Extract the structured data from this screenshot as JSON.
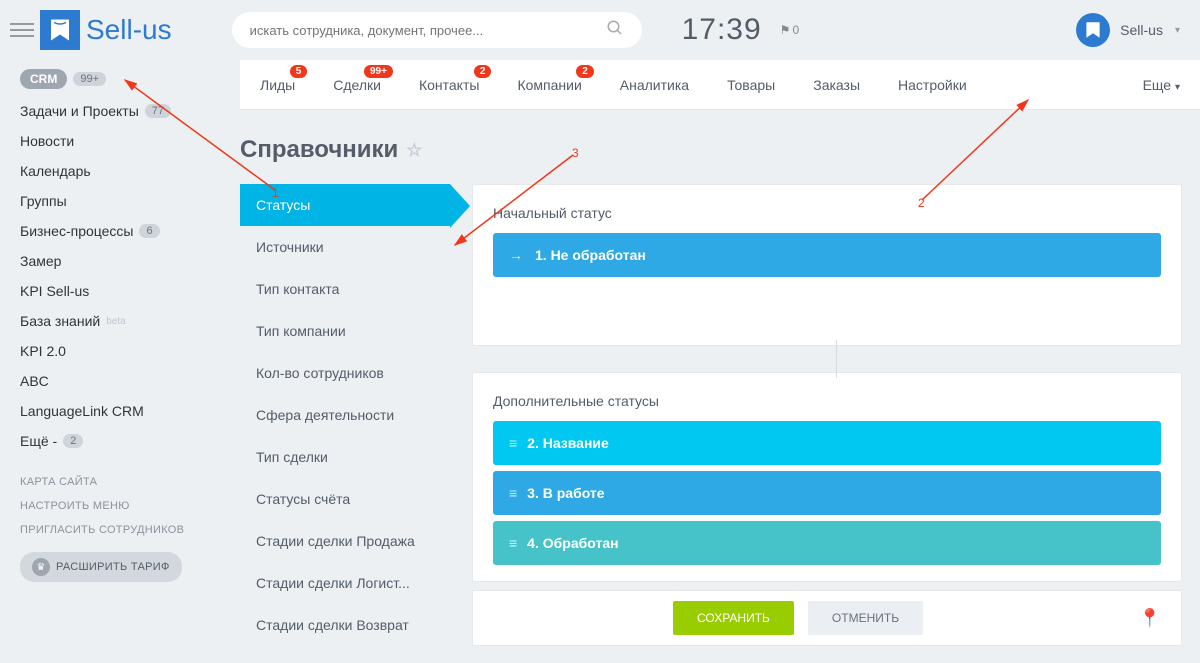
{
  "header": {
    "logo_text": "Sell-us",
    "search_placeholder": "искать сотрудника, документ, прочее...",
    "clock": "17:39",
    "flag_count": "0",
    "user_name": "Sell-us"
  },
  "sidebar": {
    "items": [
      {
        "label": "CRM",
        "badge": "99+",
        "pill": true
      },
      {
        "label": "Задачи и Проекты",
        "badge": "77"
      },
      {
        "label": "Новости"
      },
      {
        "label": "Календарь"
      },
      {
        "label": "Группы"
      },
      {
        "label": "Бизнес-процессы",
        "badge": "6"
      },
      {
        "label": "Замер"
      },
      {
        "label": "KPI Sell-us"
      },
      {
        "label": "База знаний",
        "hint": "beta"
      },
      {
        "label": "KPI 2.0"
      },
      {
        "label": "ABC"
      },
      {
        "label": "LanguageLink CRM"
      },
      {
        "label": "Ещё -",
        "badge": "2"
      }
    ],
    "footer": [
      "КАРТА САЙТА",
      "НАСТРОИТЬ МЕНЮ",
      "ПРИГЛАСИТЬ СОТРУДНИКОВ"
    ],
    "tariff": "РАСШИРИТЬ ТАРИФ"
  },
  "tabs": [
    {
      "label": "Лиды",
      "badge": "5"
    },
    {
      "label": "Сделки",
      "badge": "99+"
    },
    {
      "label": "Контакты",
      "badge": "2"
    },
    {
      "label": "Компании",
      "badge": "2"
    },
    {
      "label": "Аналитика"
    },
    {
      "label": "Товары"
    },
    {
      "label": "Заказы"
    },
    {
      "label": "Настройки"
    }
  ],
  "tabs_more": "Еще",
  "page_title": "Справочники",
  "settings_nav": [
    "Статусы",
    "Источники",
    "Тип контакта",
    "Тип компании",
    "Кол-во сотрудников",
    "Сфера деятельности",
    "Тип сделки",
    "Статусы счёта",
    "Стадии сделки Продажа",
    "Стадии сделки Логист...",
    "Стадии сделки Возврат"
  ],
  "statuses": {
    "initial_label": "Начальный статус",
    "initial": {
      "text": "1. Не обработан",
      "color": "#2fa8e6"
    },
    "additional_label": "Дополнительные статусы",
    "additional": [
      {
        "text": "2. Название",
        "color": "#00c8f0"
      },
      {
        "text": "3. В работе",
        "color": "#2fa8e6"
      },
      {
        "text": "4. Обработан",
        "color": "#45c3c9"
      }
    ]
  },
  "actions": {
    "save": "СОХРАНИТЬ",
    "cancel": "ОТМЕНИТЬ"
  },
  "annotations": {
    "n1": "1",
    "n2": "2",
    "n3": "3"
  }
}
